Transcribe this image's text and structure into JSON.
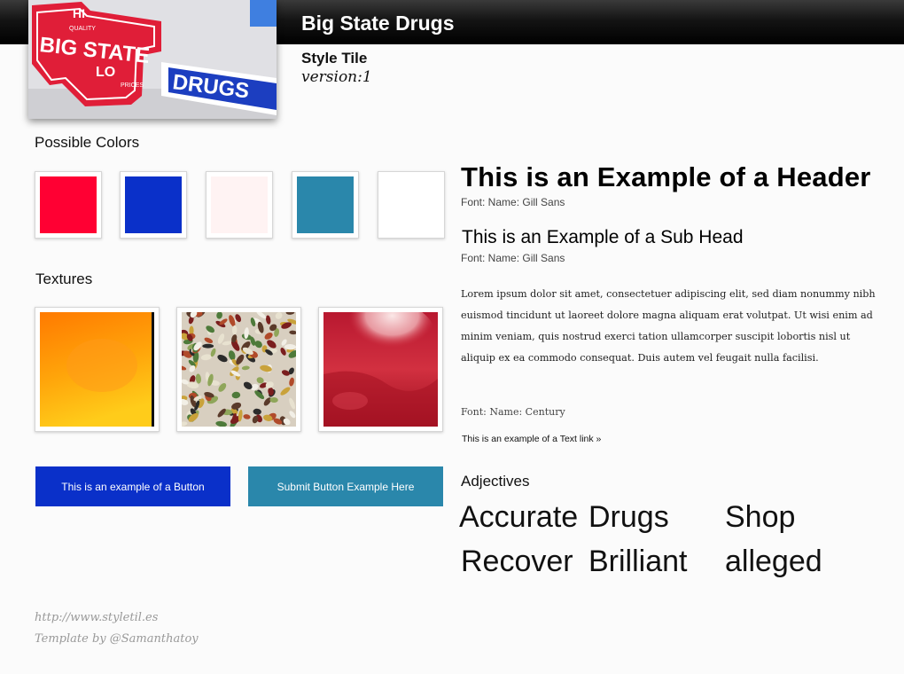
{
  "header": {
    "brand_title": "Big State Drugs",
    "style_tile_label": "Style Tile",
    "version": "version:1"
  },
  "logo": {
    "sign_texts": [
      "HI",
      "QUALITY",
      "BIG STATE",
      "LO",
      "PRICES",
      "DRUGS"
    ]
  },
  "colors_section": {
    "heading": "Possible Colors",
    "swatches": [
      "#ff0033",
      "#0a30c9",
      "#fff3f3",
      "#2a87ab",
      "#ffffff"
    ]
  },
  "textures_section": {
    "heading": "Textures",
    "items": [
      "orange-gradient-texture",
      "pills-texture",
      "red-liquid-texture"
    ]
  },
  "buttons": {
    "primary_label": "This is an example of a Button",
    "submit_label": "Submit Button Example Here"
  },
  "typography": {
    "header_example": "This is an Example of a Header",
    "header_font_note": "Font: Name: Gill Sans",
    "subhead_example": "This is an Example of a Sub Head",
    "subhead_font_note": "Font: Name: Gill Sans",
    "body_text": "Lorem ipsum dolor sit amet, consectetuer adipiscing elit, sed diam nonummy nibh euismod tincidunt ut laoreet dolore magna aliquam erat volutpat. Ut wisi enim ad minim veniam, quis nostrud exerci tation ullamcorper suscipit lobortis nisl ut aliquip ex ea commodo consequat. Duis autem vel feugait nulla facilisi.",
    "body_font_note": "Font: Name: Century",
    "text_link": "This is an example of a Text link »"
  },
  "adjectives": {
    "heading": "Adjectives",
    "words": [
      "Accurate",
      "Drugs",
      "Shop",
      "Recover",
      "Brilliant",
      "alleged"
    ]
  },
  "footer": {
    "url": "http://www.styletil.es",
    "credit": "Template by @Samanthatoy"
  }
}
